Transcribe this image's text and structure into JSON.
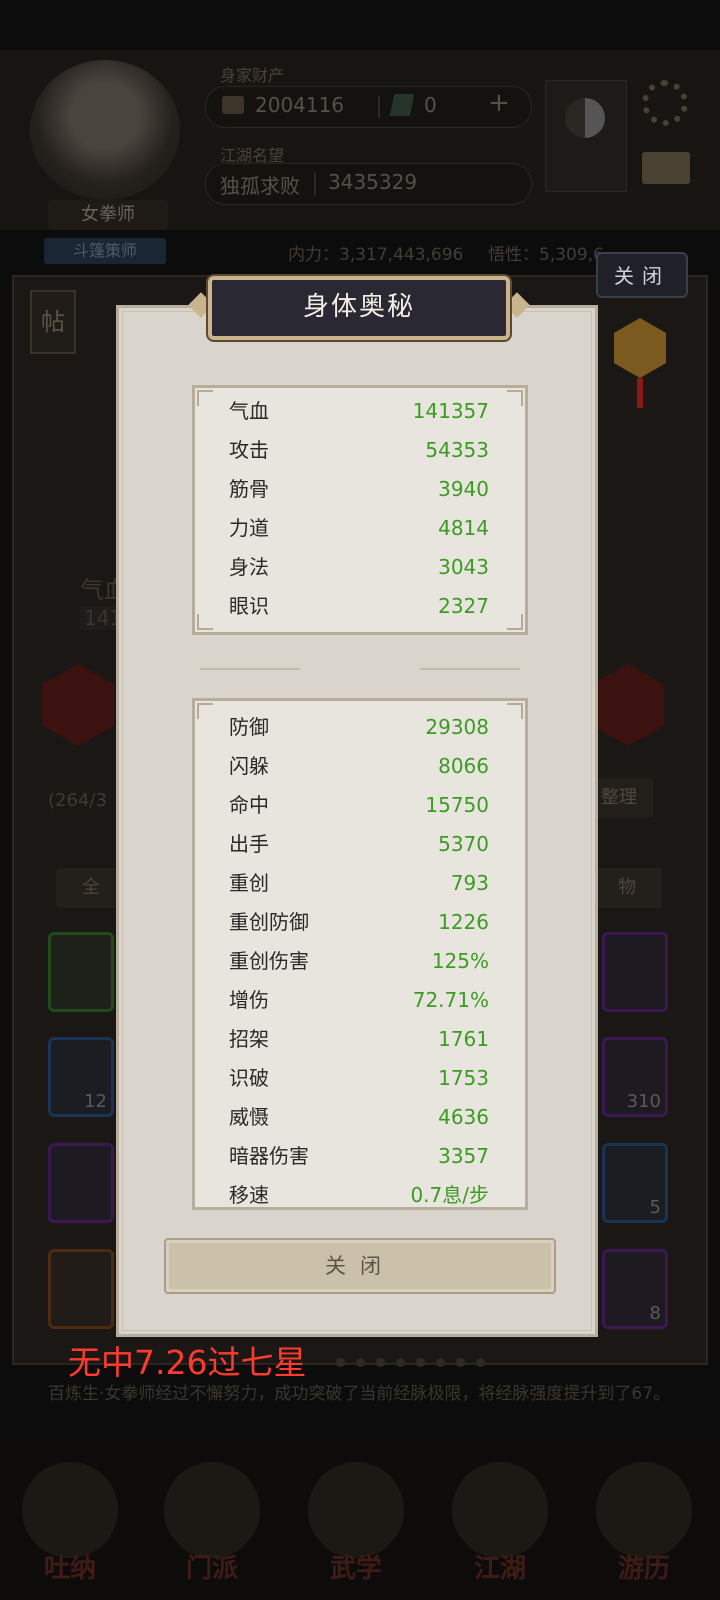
{
  "background": {
    "wealth_label": "身家财产",
    "coins": "2004116",
    "gems": "0",
    "plus_icon": "plus-icon",
    "title_label": "江湖名望",
    "rank_title": "独孤求败",
    "rank_score": "3435329",
    "char_name": "女拳师",
    "char_tag": "斗篷策师",
    "inner_power": "内力：3,317,443,696",
    "comprehension": "悟性：5,309,6..",
    "tie_char": "帖",
    "hp_fragment": "气血",
    "hp_value_fragment": "141",
    "bag_count": "(264/3",
    "sort_label": "整理",
    "tab_all": "全",
    "tab_item": "物",
    "slot_counts": [
      "12",
      "310",
      "5",
      "8"
    ],
    "log_text": "百炼生·女拳师经过不懈努力，成功突破了当前经脉极限，将经脉强度提升到了67。",
    "nav": [
      "吐纳",
      "门派",
      "武学",
      "江湖",
      "游历"
    ]
  },
  "close_top_label": "关闭",
  "modal": {
    "title": "身体奥秘",
    "primary_stats": [
      {
        "label": "气血",
        "value": "141357"
      },
      {
        "label": "攻击",
        "value": "54353"
      },
      {
        "label": "筋骨",
        "value": "3940"
      },
      {
        "label": "力道",
        "value": "4814"
      },
      {
        "label": "身法",
        "value": "3043"
      },
      {
        "label": "眼识",
        "value": "2327"
      }
    ],
    "secondary_stats": [
      {
        "label": "防御",
        "value": "29308"
      },
      {
        "label": "闪躲",
        "value": "8066"
      },
      {
        "label": "命中",
        "value": "15750"
      },
      {
        "label": "出手",
        "value": "5370"
      },
      {
        "label": "重创",
        "value": "793"
      },
      {
        "label": "重创防御",
        "value": "1226"
      },
      {
        "label": "重创伤害",
        "value": "125%"
      },
      {
        "label": "增伤",
        "value": "72.71%"
      },
      {
        "label": "招架",
        "value": "1761"
      },
      {
        "label": "识破",
        "value": "1753"
      },
      {
        "label": "威慑",
        "value": "4636"
      },
      {
        "label": "暗器伤害",
        "value": "3357"
      },
      {
        "label": "移速",
        "value": "0.7息/步"
      }
    ],
    "close_label": "关闭"
  },
  "overlay_text": "无中7.26过七星",
  "colors": {
    "stat_value": "#3c9b22",
    "modal_bg": "#d9d4cc",
    "title_plate": "#2a2833",
    "overlay_red": "#ff3b30"
  }
}
